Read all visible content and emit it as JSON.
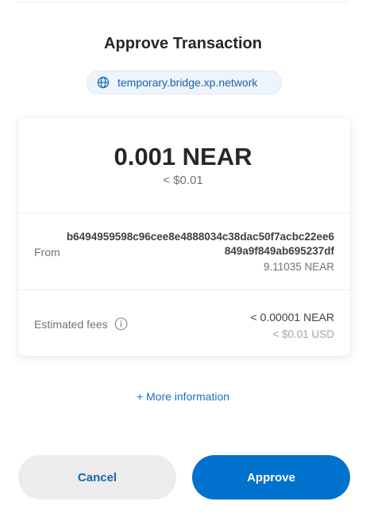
{
  "header": {
    "title": "Approve Transaction"
  },
  "origin": {
    "icon": "globe-icon",
    "host": "temporary.bridge.xp.network"
  },
  "transfer": {
    "amount": "0.001 NEAR",
    "amount_usd": "< $0.01"
  },
  "from": {
    "label": "From",
    "address": "b6494959598c96cee8e4888034c38dac50f7acbc22ee6849a9f849ab695237df",
    "balance": "9.11035 NEAR"
  },
  "fees": {
    "label": "Estimated fees",
    "icon": "info-icon",
    "near": "< 0.00001 NEAR",
    "usd": "< $0.01 USD"
  },
  "more_info": {
    "label": "+ More information"
  },
  "actions": {
    "cancel_label": "Cancel",
    "approve_label": "Approve"
  },
  "colors": {
    "accent": "#0072ce",
    "link": "#1c6ec8",
    "pill_bg": "#eef4fb",
    "cancel_bg": "#ececec"
  }
}
